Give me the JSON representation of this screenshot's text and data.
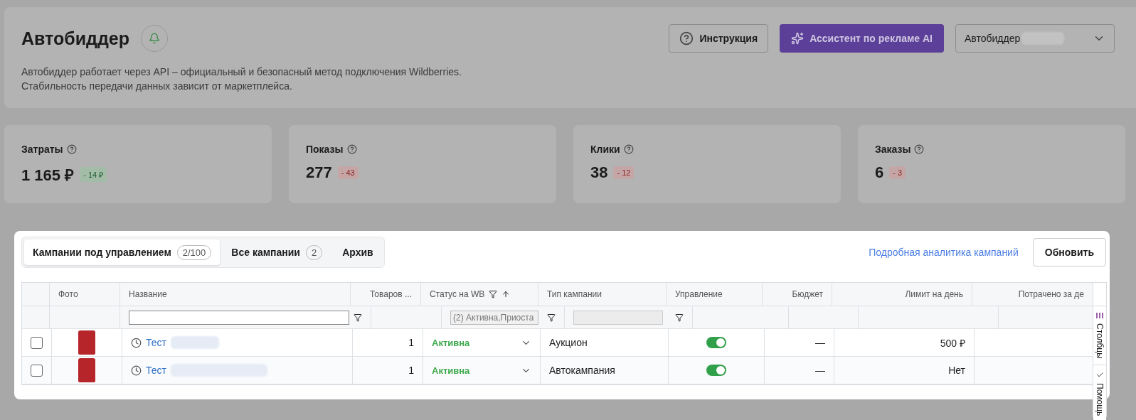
{
  "header": {
    "title": "Автобиддер",
    "description": [
      "Автобиддер работает через API – официальный и безопасный метод подключения Wildberries.",
      "Стабильность передачи данных зависит от маркетплейса."
    ],
    "help_button": "Инструкция",
    "assistant_button": "Ассистент по рекламе AI",
    "account_select": "Автобиддер"
  },
  "stats": [
    {
      "label": "Затраты",
      "value": "1 165 ₽",
      "delta": "- 14 ₽",
      "improved": true
    },
    {
      "label": "Показы",
      "value": "277",
      "delta": "- 43",
      "improved": false
    },
    {
      "label": "Клики",
      "value": "38",
      "delta": "- 12",
      "improved": false
    },
    {
      "label": "Заказы",
      "value": "6",
      "delta": "- 3",
      "improved": false
    }
  ],
  "tabs": [
    {
      "label": "Кампании под управлением",
      "count": "2/100",
      "selected": true
    },
    {
      "label": "Все кампании",
      "count": "2",
      "selected": false
    },
    {
      "label": "Архив",
      "selected": false
    }
  ],
  "analytics_link": "Подробная аналитика кампаний",
  "refresh_button": "Обновить",
  "table": {
    "columns": [
      {},
      {
        "label": "Фото"
      },
      {
        "label": "Название",
        "filter": {
          "kind": "text"
        }
      },
      {
        "label": "Товаров ..."
      },
      {
        "label": "Статус на WB",
        "filter": {
          "kind": "select",
          "value": "(2) Активна,Приоста"
        },
        "filtered": true,
        "sorted_ascending": true
      },
      {
        "label": "Тип кампании",
        "filter": {
          "kind": "disabled"
        }
      },
      {
        "label": "Управление"
      },
      {
        "label": "Бюджет"
      },
      {
        "label": "Лимит на день"
      },
      {
        "label": "Потрачено за де"
      }
    ],
    "rows": [
      {
        "checked": false,
        "name": "Тест",
        "count": "1",
        "status": "Активна",
        "type": "Аукцион",
        "managed": true,
        "budget": "—",
        "limit": "500 ₽"
      },
      {
        "checked": false,
        "name": "Тест",
        "count": "1",
        "status": "Активна",
        "type": "Автокампания",
        "managed": true,
        "budget": "—",
        "limit": "Нет"
      }
    ]
  },
  "side_tabs": [
    {
      "kind": "columns",
      "label": "Столбцы"
    },
    {
      "kind": "help",
      "label": "Помощь"
    }
  ]
}
